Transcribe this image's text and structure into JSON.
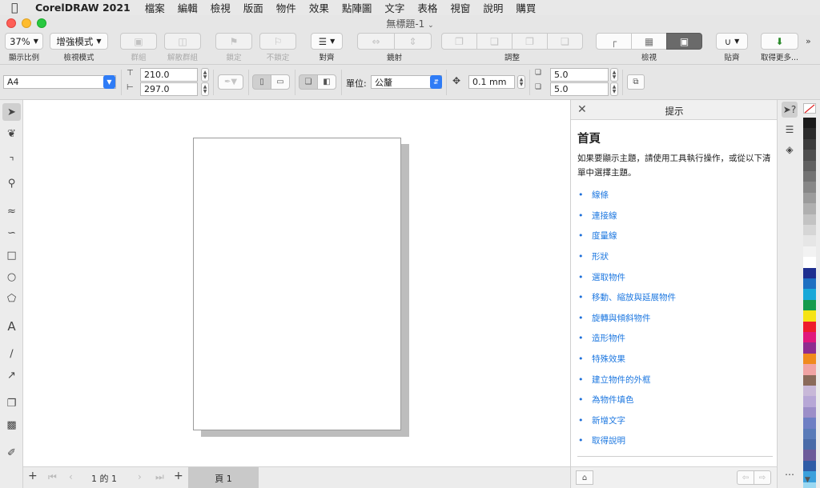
{
  "menubar": {
    "app_name": "CorelDRAW 2021",
    "items": [
      "檔案",
      "編輯",
      "檢視",
      "版面",
      "物件",
      "效果",
      "點陣圖",
      "文字",
      "表格",
      "視窗",
      "說明",
      "購買"
    ]
  },
  "window": {
    "title": "無標題-1"
  },
  "toolbar": {
    "zoom_value": "37%",
    "zoom_label": "顯示比例",
    "view_mode_value": "增強模式",
    "view_mode_label": "檢視模式",
    "group_label": "群組",
    "ungroup_label": "解散群組",
    "lock_label": "鎖定",
    "unlock_label": "不鎖定",
    "align_label": "對齊",
    "mirror_label": "鏡射",
    "adjust_label": "調整",
    "view_label": "檢視",
    "snap_label": "貼齊",
    "get_more_label": "取得更多..."
  },
  "propbar": {
    "paper_size": "A4",
    "width": "210.0",
    "height": "297.0",
    "units_label": "單位:",
    "units_value": "公釐",
    "nudge": "0.1 mm",
    "dup_x": "5.0",
    "dup_y": "5.0"
  },
  "pagenav": {
    "page_counter": "1 的 1",
    "page_tab": "頁 1"
  },
  "hints": {
    "title": "提示",
    "home": "首頁",
    "intro": "如果要顯示主題，請使用工具執行操作，或從以下清單中選擇主題。",
    "topics": [
      "線條",
      "連接線",
      "度量線",
      "形狀",
      "選取物件",
      "移動、縮放與延展物件",
      "旋轉與傾斜物件",
      "造形物件",
      "特殊效果",
      "建立物件的外框",
      "為物件填色",
      "新增文字",
      "取得說明"
    ]
  },
  "colors": {
    "accent": "#2f7cf6",
    "link": "#1e78e0",
    "palette": [
      "#1a1a1a",
      "#2b2b2b",
      "#3c3c3c",
      "#4e4e4e",
      "#606060",
      "#737373",
      "#878787",
      "#9b9b9b",
      "#afafaf",
      "#c3c3c3",
      "#d6d6d6",
      "#e6e6e6",
      "#f2f2f2",
      "#ffffff",
      "#1f2f8f",
      "#1d6fc1",
      "#18a8d8",
      "#139a4b",
      "#f6e315",
      "#ee1c2b",
      "#e0177c",
      "#8e2c8f",
      "#f08a1d",
      "#f0a3a3",
      "#8a6a5a",
      "#c8b8d8",
      "#b7a7d6",
      "#9c8ec8",
      "#6e7fc4",
      "#5a7bb8",
      "#4a6ba8",
      "#6d5b9a",
      "#2f5ca6",
      "#3aa0dc",
      "#9ad8f2"
    ]
  }
}
